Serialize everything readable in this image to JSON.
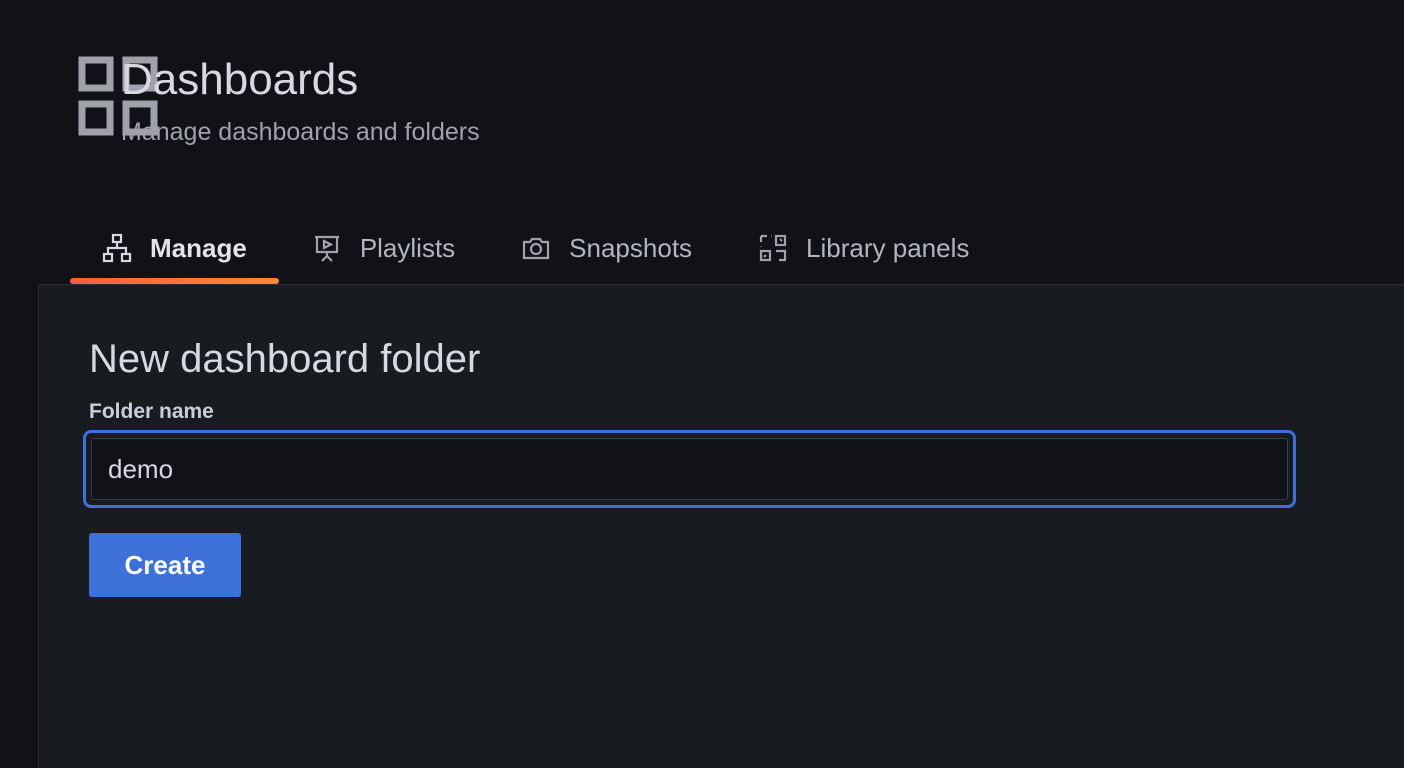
{
  "header": {
    "icon": "apps-grid-icon",
    "title": "Dashboards",
    "subtitle": "Manage dashboards and folders"
  },
  "tabs": [
    {
      "label": "Manage",
      "icon": "sitemap-icon",
      "active": true
    },
    {
      "label": "Playlists",
      "icon": "presentation-play-icon",
      "active": false
    },
    {
      "label": "Snapshots",
      "icon": "camera-icon",
      "active": false
    },
    {
      "label": "Library panels",
      "icon": "library-panel-icon",
      "active": false
    }
  ],
  "form": {
    "heading": "New dashboard folder",
    "folder_name_label": "Folder name",
    "folder_name_value": "demo",
    "create_label": "Create"
  },
  "colors": {
    "background": "#111217",
    "panel": "#181b1f",
    "primary": "#3d71d9",
    "active_tab_underline": "#ff8833"
  }
}
